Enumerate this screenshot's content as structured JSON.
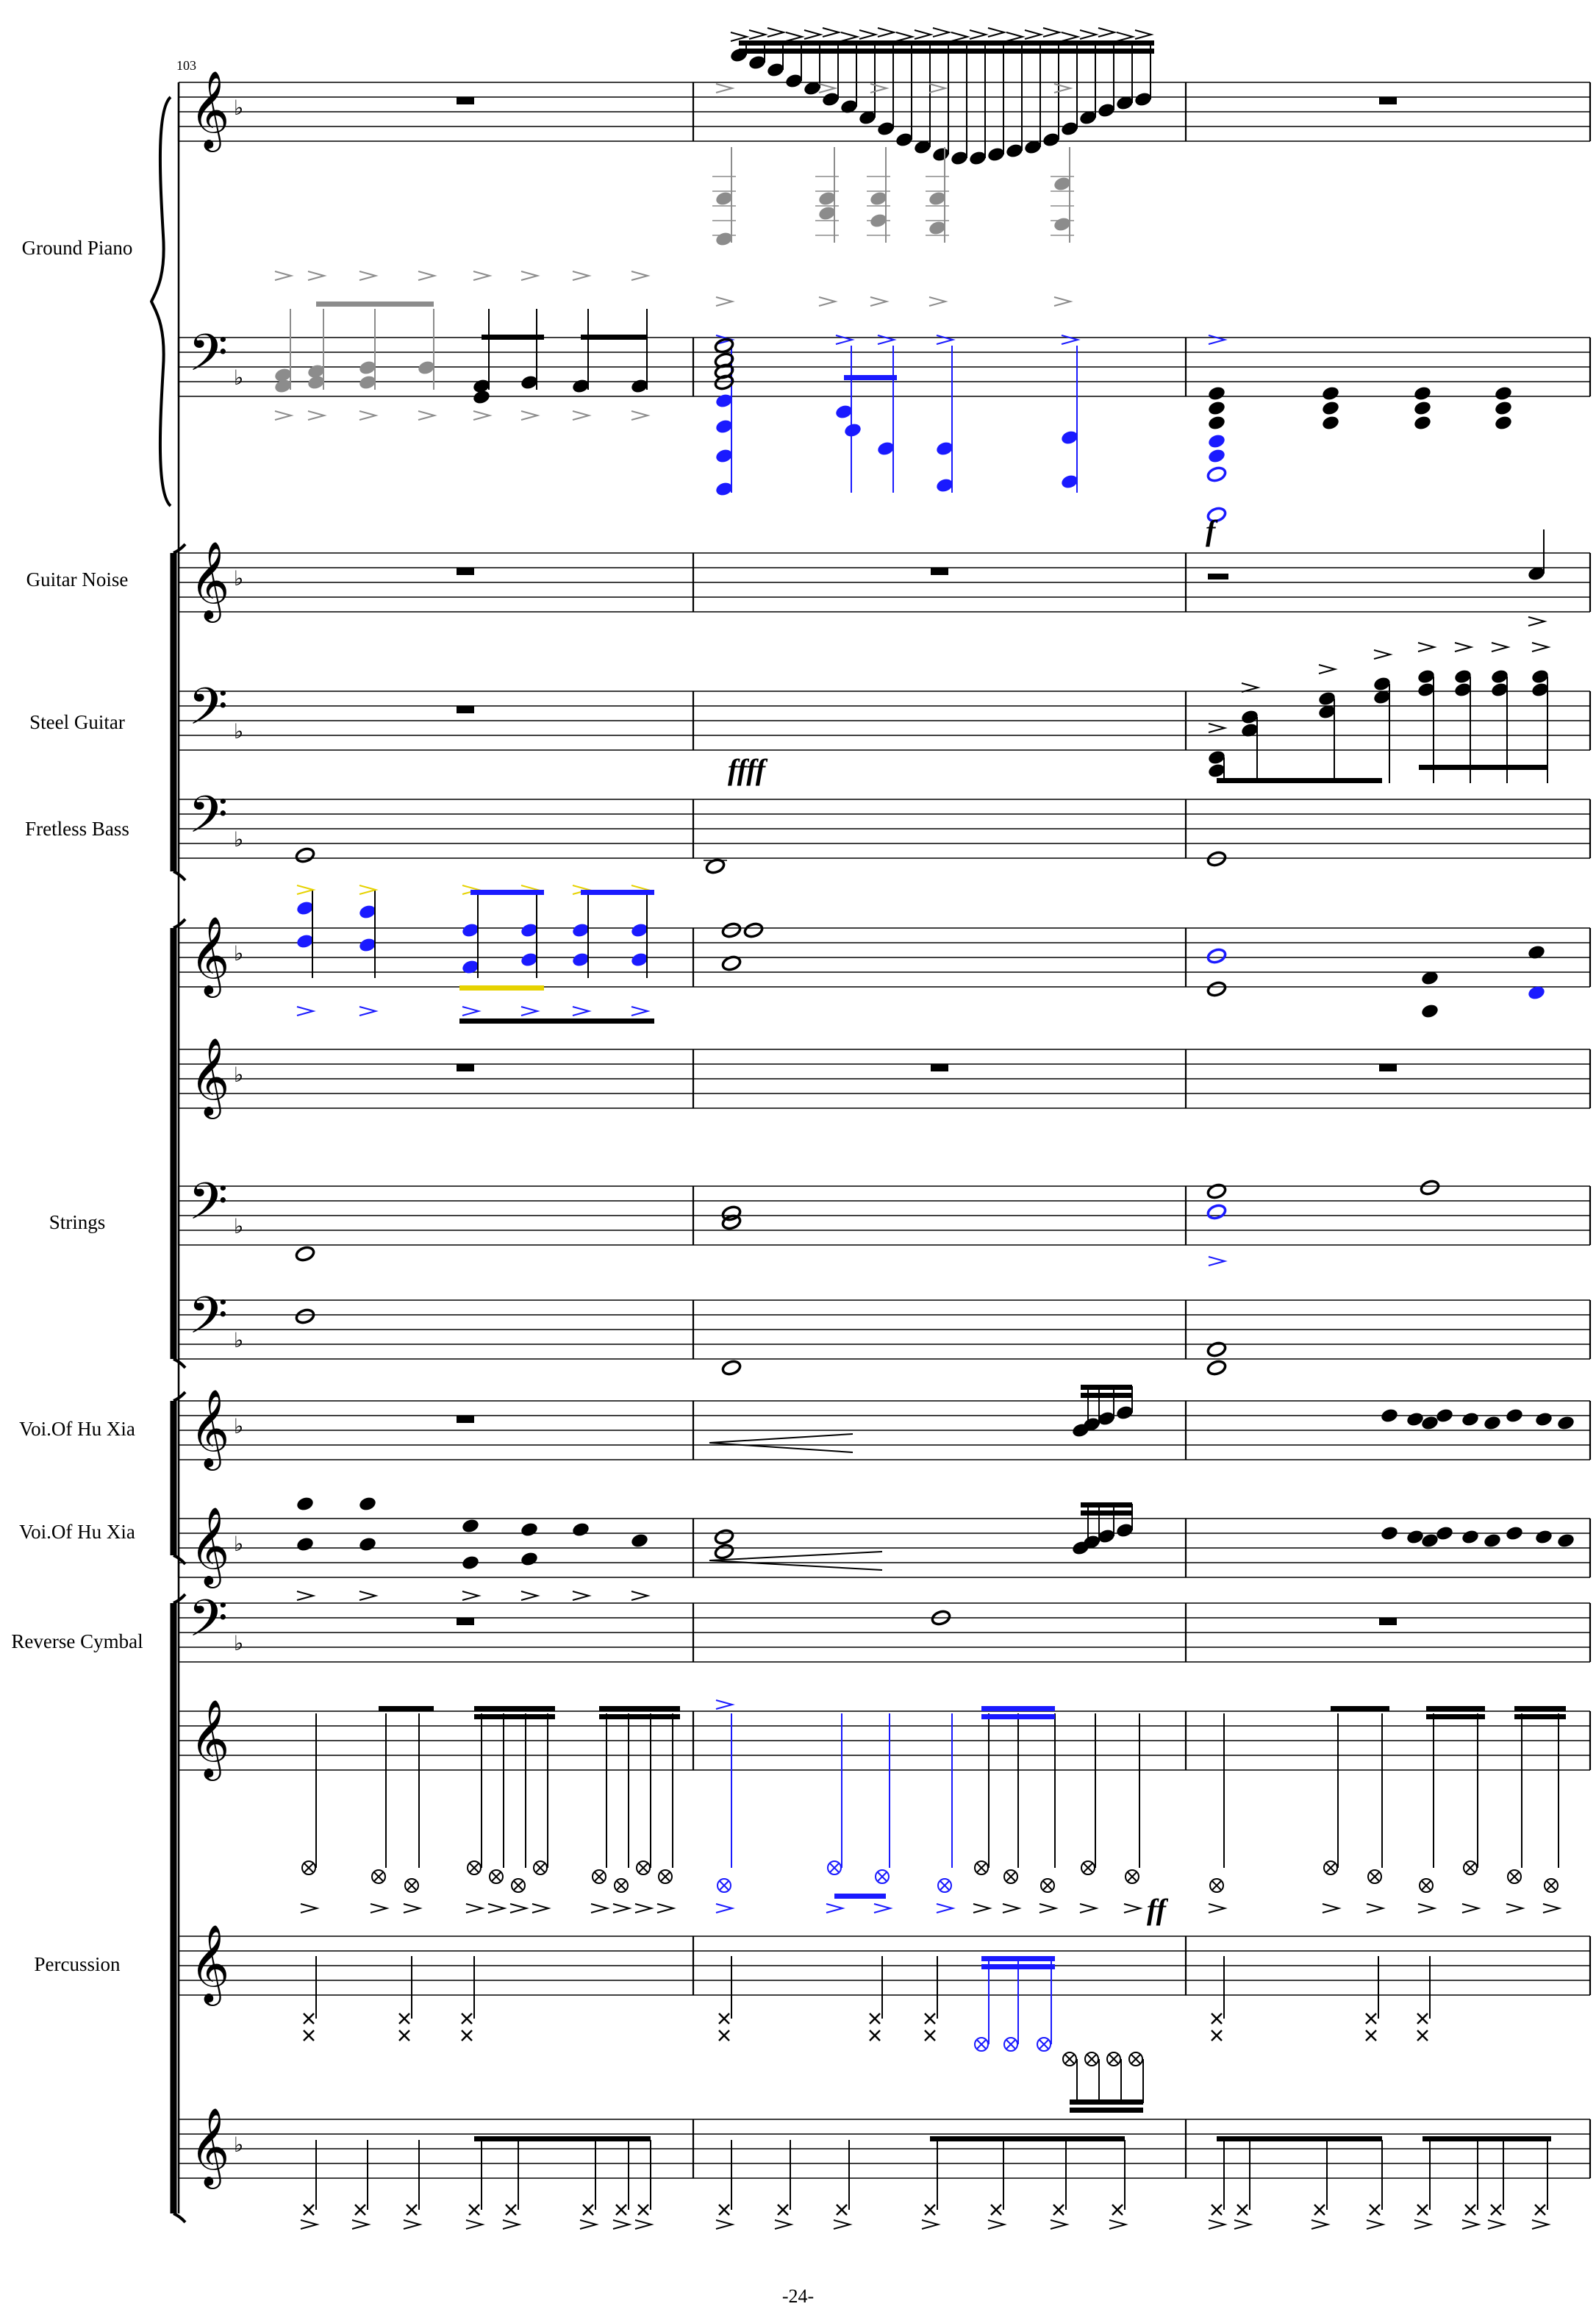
{
  "measure_number": "103",
  "page_number": "-24-",
  "instruments": [
    {
      "name": "Ground Piano"
    },
    {
      "name": "Guitar Noise"
    },
    {
      "name": "Steel Guitar"
    },
    {
      "name": "Fretless Bass"
    },
    {
      "name": "Strings"
    },
    {
      "name": "Voi.Of Hu Xia"
    },
    {
      "name": "Voi.Of Hu Xia"
    },
    {
      "name": "Reverse Cymbal"
    },
    {
      "name": "Percussion"
    }
  ],
  "dynamics": {
    "steel_guitar": "ffff",
    "piano_bass": "f",
    "percussion": "ff"
  },
  "colors": {
    "staff": "#000000",
    "voice_blue": "#1a1aff",
    "voice_gray": "#8c8c8c",
    "voice_yellow": "#e6d200"
  },
  "key_signature": "F major (one flat)",
  "measures_per_system": 3
}
